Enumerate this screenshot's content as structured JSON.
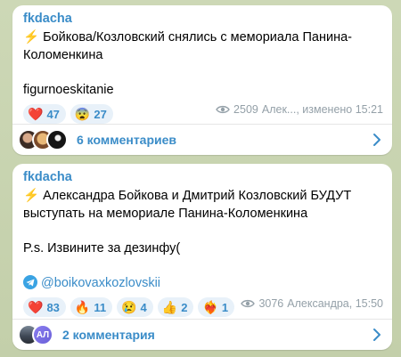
{
  "posts": [
    {
      "channel": "fkdacha",
      "text_lines": [
        "⚡ Бойкова/Козловский снялись с мемориала Панина-",
        "Коломенкина",
        "",
        "figurnoeskitanie"
      ],
      "reactions": [
        {
          "emoji": "❤️",
          "icon": "heart-icon",
          "count": "47"
        },
        {
          "emoji": "😨",
          "icon": "fearful-face-icon",
          "count": "27"
        }
      ],
      "views": "2509",
      "meta": "Алек..., изменено 15:21",
      "comments_label": "6 комментариев"
    },
    {
      "channel": "fkdacha",
      "text_lines": [
        "⚡ Александра Бойкова и Дмитрий Козловский БУДУТ",
        "выступать на мемориале Панина-Коломенкина",
        "",
        "P.s. Извините за дезинфу(",
        ""
      ],
      "link": "@boikovaxkozlovskii",
      "reactions": [
        {
          "emoji": "❤️",
          "icon": "heart-icon",
          "count": "83"
        },
        {
          "emoji": "🔥",
          "icon": "fire-icon",
          "count": "11"
        },
        {
          "emoji": "😢",
          "icon": "crying-face-icon",
          "count": "4"
        },
        {
          "emoji": "👍",
          "icon": "thumbs-up-icon",
          "count": "2"
        },
        {
          "emoji": "❤️‍🔥",
          "icon": "heart-on-fire-icon",
          "count": "1"
        }
      ],
      "views": "3076",
      "meta": "Александра, 15:50",
      "comments_label": "2 комментария",
      "avatar_initials": "АЛ"
    }
  ],
  "colors": {
    "accent": "#3a8cc8",
    "reaction_bg": "#e8f1f9",
    "meta": "#94a0a8",
    "background": "#c9d4b4"
  }
}
